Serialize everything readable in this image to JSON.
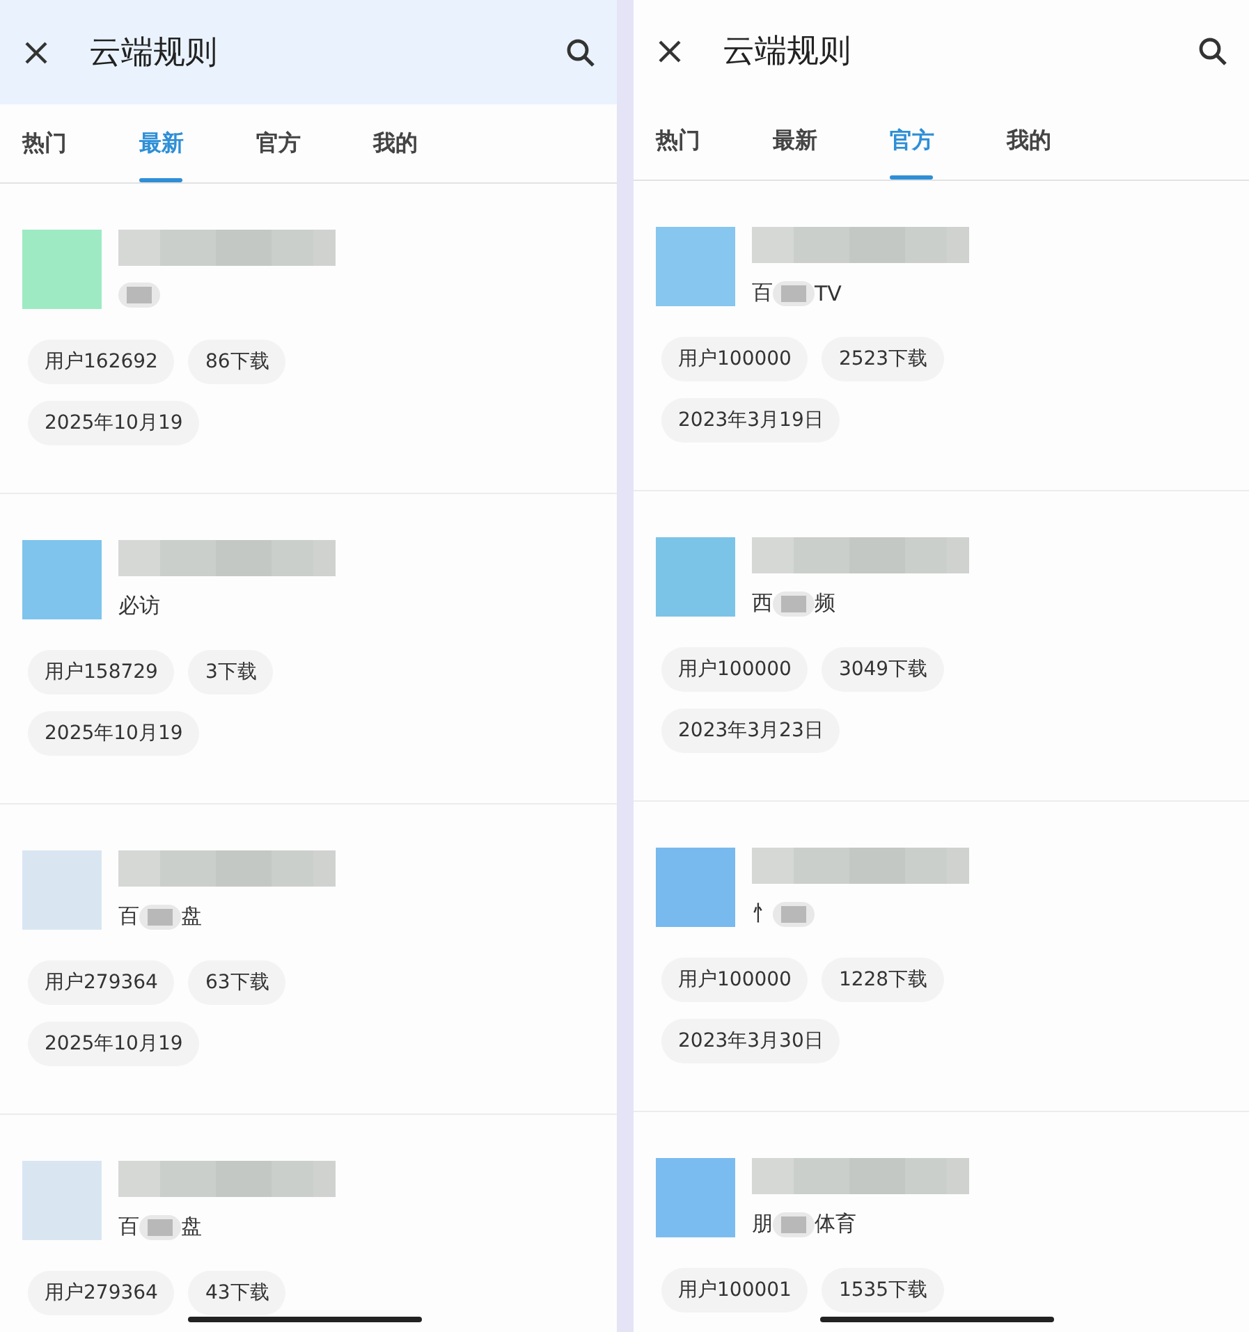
{
  "panels": [
    {
      "header": {
        "title": "云端规则",
        "tinted": true
      },
      "tabs": [
        {
          "label": "热门",
          "selected": false
        },
        {
          "label": "最新",
          "selected": true
        },
        {
          "label": "官方",
          "selected": false
        },
        {
          "label": "我的",
          "selected": false
        }
      ],
      "rules": [
        {
          "color": "#9eeac3",
          "subtitle": [
            {
              "kind": "blur"
            }
          ],
          "chips": [
            "用户162692",
            "86下载",
            "2025年10月19"
          ]
        },
        {
          "color": "#7fc4ec",
          "subtitle": [
            {
              "kind": "text",
              "text": "必访"
            }
          ],
          "chips": [
            "用户158729",
            "3下载",
            "2025年10月19"
          ]
        },
        {
          "color": "#d9e6f2",
          "subtitle": [
            {
              "kind": "text",
              "text": "百"
            },
            {
              "kind": "blur"
            },
            {
              "kind": "text",
              "text": "盘"
            }
          ],
          "chips": [
            "用户279364",
            "63下载",
            "2025年10月19"
          ]
        },
        {
          "color": "#d9e6f2",
          "subtitle": [
            {
              "kind": "text",
              "text": "百"
            },
            {
              "kind": "blur"
            },
            {
              "kind": "text",
              "text": "盘"
            }
          ],
          "chips": [
            "用户279364",
            "43下载"
          ]
        }
      ]
    },
    {
      "header": {
        "title": "云端规则",
        "tinted": false
      },
      "tabs": [
        {
          "label": "热门",
          "selected": false
        },
        {
          "label": "最新",
          "selected": false
        },
        {
          "label": "官方",
          "selected": true
        },
        {
          "label": "我的",
          "selected": false
        }
      ],
      "rules": [
        {
          "color": "#86c6ef",
          "subtitle": [
            {
              "kind": "text",
              "text": "百"
            },
            {
              "kind": "blur"
            },
            {
              "kind": "text",
              "text": "TV"
            }
          ],
          "chips": [
            "用户100000",
            "2523下载",
            "2023年3月19日"
          ]
        },
        {
          "color": "#7cc3e8",
          "subtitle": [
            {
              "kind": "text",
              "text": "西"
            },
            {
              "kind": "blur"
            },
            {
              "kind": "text",
              "text": "频"
            }
          ],
          "chips": [
            "用户100000",
            "3049下载",
            "2023年3月23日"
          ]
        },
        {
          "color": "#78b9ee",
          "subtitle": [
            {
              "kind": "text",
              "text": "忄"
            },
            {
              "kind": "blur"
            }
          ],
          "chips": [
            "用户100000",
            "1228下载",
            "2023年3月30日"
          ]
        },
        {
          "color": "#7bbcf0",
          "subtitle": [
            {
              "kind": "text",
              "text": "朋"
            },
            {
              "kind": "blur"
            },
            {
              "kind": "text",
              "text": "体育"
            }
          ],
          "chips": [
            "用户100001",
            "1535下载"
          ]
        }
      ]
    }
  ]
}
